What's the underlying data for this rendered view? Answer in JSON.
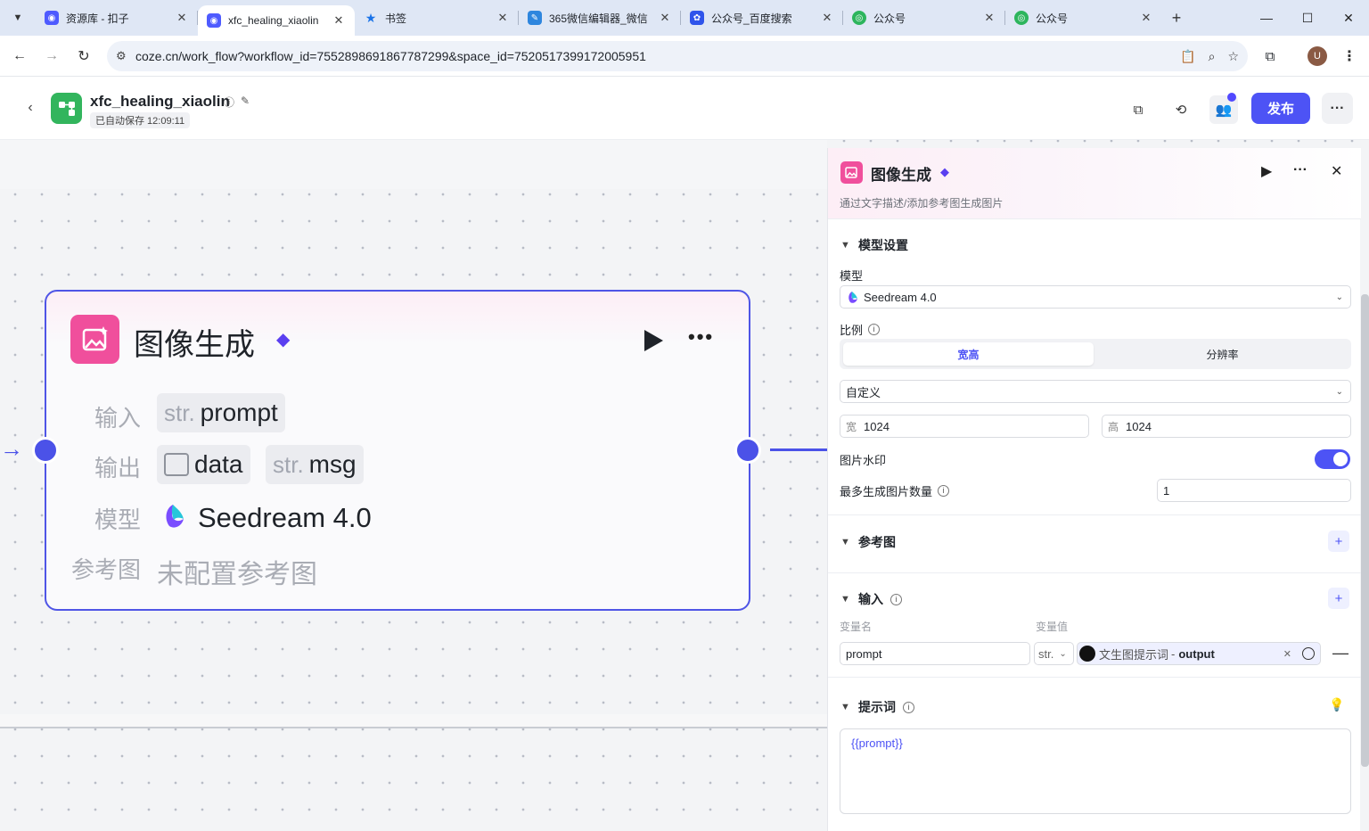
{
  "browser": {
    "tabs": [
      {
        "label": "资源库 - 扣子",
        "active": false,
        "color": "#4e5bff"
      },
      {
        "label": "xfc_healing_xiaolin",
        "active": true,
        "color": "#4e5bff"
      },
      {
        "label": "书签",
        "active": false,
        "color": "#1a73e8"
      },
      {
        "label": "365微信编辑器_微信",
        "active": false,
        "color": "#2e86de"
      },
      {
        "label": "公众号_百度搜索",
        "active": false,
        "color": "#2f54eb"
      },
      {
        "label": "公众号",
        "active": false,
        "color": "#2db55d"
      },
      {
        "label": "公众号",
        "active": false,
        "color": "#2db55d"
      }
    ],
    "url": "coze.cn/work_flow?workflow_id=7552898691867787299&space_id=7520517399172005951",
    "avatar_letter": "U"
  },
  "header": {
    "app_name": "xfc_healing_xiaolin",
    "autosave": "已自动保存 12:09:11",
    "publish_label": "发布"
  },
  "node": {
    "title": "图像生成",
    "input_label": "输入",
    "output_label": "输出",
    "model_label": "模型",
    "ref_label": "参考图",
    "input_type": "str.",
    "input_name": "prompt",
    "output_data": "data",
    "output_msg_type": "str.",
    "output_msg": "msg",
    "model_name": "Seedream 4.0",
    "ref_value": "未配置参考图"
  },
  "panel": {
    "title": "图像生成",
    "description": "通过文字描述/添加参考图生成图片",
    "model_settings": {
      "section_label": "模型设置",
      "model_label": "模型",
      "model_value": "Seedream 4.0",
      "ratio_label": "比例",
      "seg_width_height": "宽高",
      "seg_resolution": "分辨率",
      "ratio_value": "自定义",
      "width_prefix": "宽",
      "width_value": "1024",
      "height_prefix": "高",
      "height_value": "1024",
      "watermark_label": "图片水印",
      "watermark_on": true,
      "max_images_label": "最多生成图片数量",
      "max_images_value": "1"
    },
    "reference": {
      "section_label": "参考图"
    },
    "input": {
      "section_label": "输入",
      "col_name": "变量名",
      "col_value": "变量值",
      "var_name": "prompt",
      "var_type": "str.",
      "ref_source": "文生图提示词",
      "ref_sep": "-",
      "ref_output": "output"
    },
    "prompt": {
      "section_label": "提示词",
      "value": "{{prompt}}"
    }
  },
  "colors": {
    "accent": "#4d53f5",
    "node_pink": "#f04f9c",
    "brand_green": "#32b55d"
  }
}
